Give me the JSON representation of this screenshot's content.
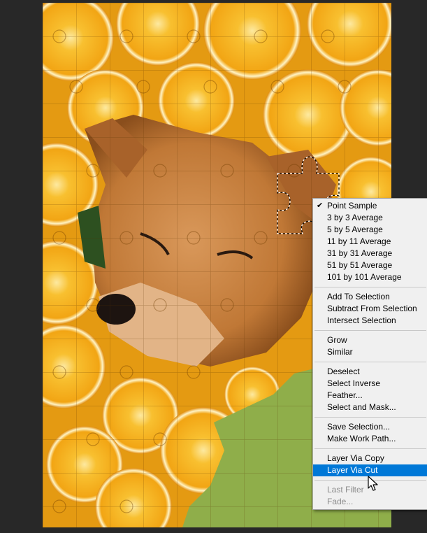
{
  "menu": {
    "groups": [
      [
        {
          "label": "Point Sample",
          "checked": true
        },
        {
          "label": "3 by 3 Average"
        },
        {
          "label": "5 by 5 Average"
        },
        {
          "label": "11 by 11 Average"
        },
        {
          "label": "31 by 31 Average"
        },
        {
          "label": "51 by 51 Average"
        },
        {
          "label": "101 by 101 Average"
        }
      ],
      [
        {
          "label": "Add To Selection"
        },
        {
          "label": "Subtract From Selection"
        },
        {
          "label": "Intersect Selection"
        }
      ],
      [
        {
          "label": "Grow"
        },
        {
          "label": "Similar"
        }
      ],
      [
        {
          "label": "Deselect"
        },
        {
          "label": "Select Inverse"
        },
        {
          "label": "Feather..."
        },
        {
          "label": "Select and Mask..."
        }
      ],
      [
        {
          "label": "Save Selection..."
        },
        {
          "label": "Make Work Path..."
        }
      ],
      [
        {
          "label": "Layer Via Copy"
        },
        {
          "label": "Layer Via Cut",
          "highlighted": true
        }
      ],
      [
        {
          "label": "Last Filter",
          "disabled": true
        },
        {
          "label": "Fade...",
          "disabled": true
        }
      ]
    ],
    "check_glyph": "✔"
  },
  "canvas": {
    "subject": "shiba-inu-dog-puzzle-image",
    "colors": {
      "orange_peel": "#e89a10",
      "orange_flesh": "#f6b41c",
      "orange_rind": "#fbe9a8",
      "dog_fur": "#c9803e",
      "background_green": "#8fae4a",
      "workspace": "#282828",
      "menu_bg": "#f0f0f0",
      "menu_highlight": "#0078d7"
    }
  }
}
